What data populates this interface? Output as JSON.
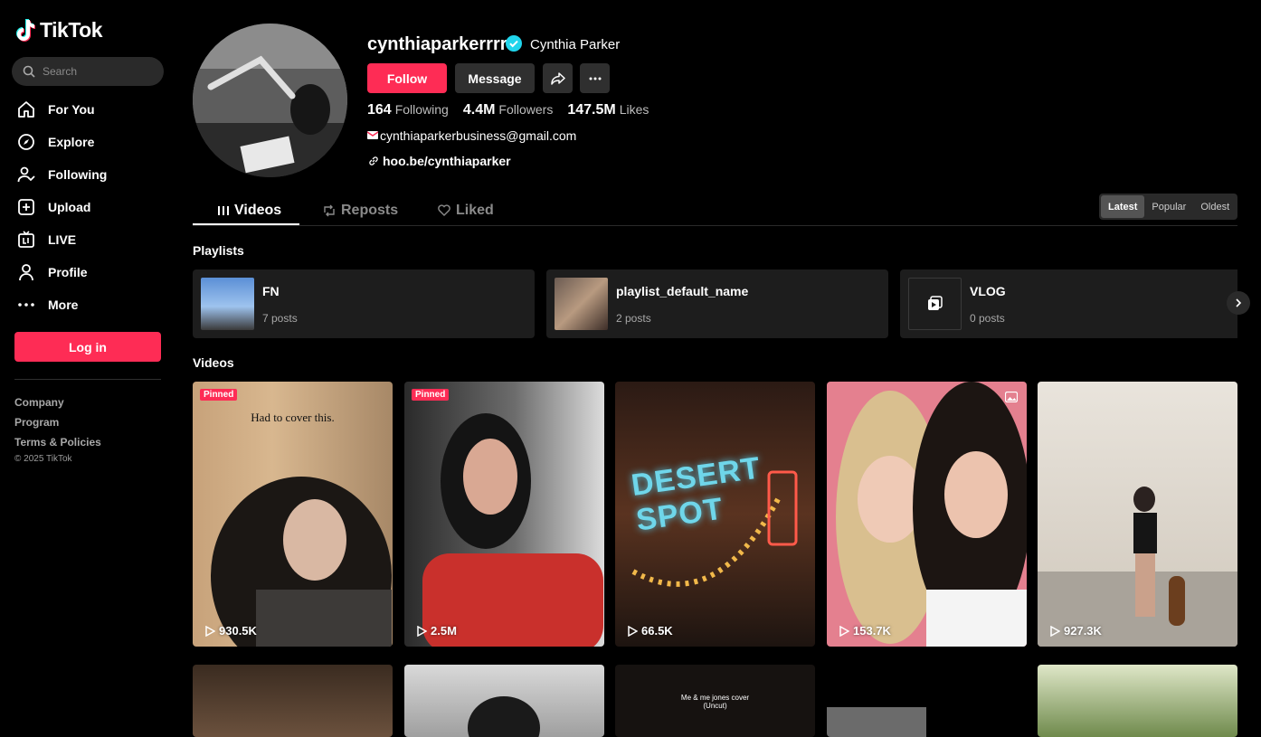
{
  "app": {
    "name": "TikTok"
  },
  "search": {
    "placeholder": "Search"
  },
  "nav": [
    {
      "label": "For You",
      "icon": "home-icon"
    },
    {
      "label": "Explore",
      "icon": "compass-icon"
    },
    {
      "label": "Following",
      "icon": "following-icon"
    },
    {
      "label": "Upload",
      "icon": "upload-icon"
    },
    {
      "label": "LIVE",
      "icon": "live-icon"
    },
    {
      "label": "Profile",
      "icon": "profile-icon"
    },
    {
      "label": "More",
      "icon": "more-icon"
    }
  ],
  "login_label": "Log in",
  "footer": {
    "links": [
      "Company",
      "Program",
      "Terms & Policies"
    ],
    "copyright": "© 2025 TikTok"
  },
  "profile": {
    "username": "cynthiaparkerrrr",
    "display_name": "Cynthia Parker",
    "follow_label": "Follow",
    "message_label": "Message",
    "stats": [
      {
        "value": "164",
        "label": "Following"
      },
      {
        "value": "4.4M",
        "label": "Followers"
      },
      {
        "value": "147.5M",
        "label": "Likes"
      }
    ],
    "bio_email": "cynthiaparkerbusiness@gmail.com",
    "link": "hoo.be/cynthiaparker"
  },
  "tabs": [
    {
      "label": "Videos",
      "active": true
    },
    {
      "label": "Reposts",
      "active": false
    },
    {
      "label": "Liked",
      "active": false
    }
  ],
  "sort": [
    {
      "label": "Latest",
      "active": true
    },
    {
      "label": "Popular",
      "active": false
    },
    {
      "label": "Oldest",
      "active": false
    }
  ],
  "playlists_heading": "Playlists",
  "playlists": [
    {
      "title": "FN",
      "count": "7 posts"
    },
    {
      "title": "playlist_default_name",
      "count": "2 posts"
    },
    {
      "title": "VLOG",
      "count": "0 posts"
    }
  ],
  "videos_heading": "Videos",
  "videos": [
    {
      "views": "930.5K",
      "pinned": "Pinned",
      "caption": "Had to cover this."
    },
    {
      "views": "2.5M",
      "pinned": "Pinned"
    },
    {
      "views": "66.5K",
      "overlay_text": "DESERT SPOT"
    },
    {
      "views": "153.7K"
    },
    {
      "views": "927.3K"
    }
  ],
  "videos_row2": [
    {
      "caption": "Me & me jones cover\n(Uncut)"
    }
  ],
  "colors": {
    "accent": "#fe2c55",
    "verified": "#20d5ec",
    "background": "#000000"
  }
}
